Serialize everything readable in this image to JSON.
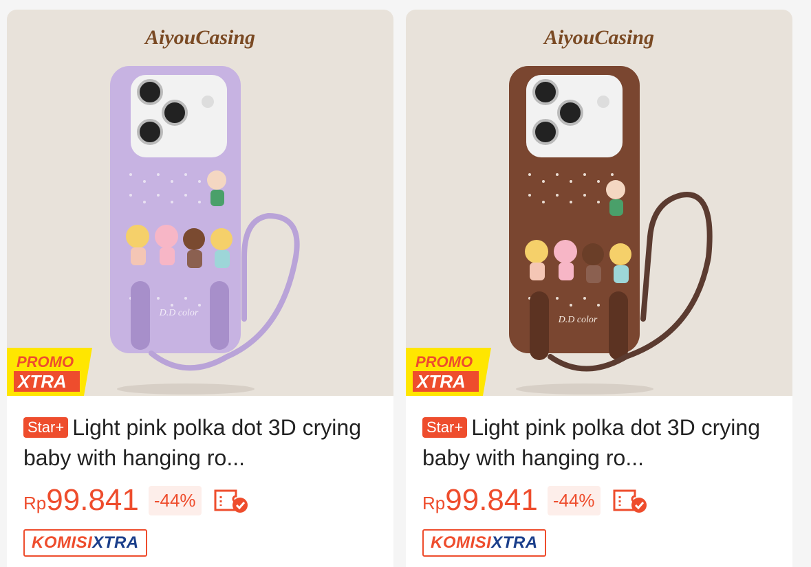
{
  "products": [
    {
      "brand": "AiyouCasing",
      "case_color": "#c7b3e2",
      "strap_color": "#b9a3d8",
      "promo_line1": "PROMO",
      "promo_line2": "XTRA",
      "case_text": "D.D color",
      "badge": "Star+",
      "title": "Light pink polka dot 3D crying baby with hanging ro...",
      "currency": "Rp",
      "price": "99.841",
      "discount": "-44%",
      "komisi_part1": "KOMISI",
      "komisi_part2": "XTRA"
    },
    {
      "brand": "AiyouCasing",
      "case_color": "#7a4630",
      "strap_color": "#5b3b30",
      "promo_line1": "PROMO",
      "promo_line2": "XTRA",
      "case_text": "D.D color",
      "badge": "Star+",
      "title": "Light pink polka dot 3D crying baby with hanging ro...",
      "currency": "Rp",
      "price": "99.841",
      "discount": "-44%",
      "komisi_part1": "KOMISI",
      "komisi_part2": "XTRA"
    }
  ],
  "colors": {
    "accent": "#ee4d2d",
    "promo_yellow": "#ffe600",
    "komisi_blue": "#1b3f8b"
  },
  "icons": {
    "voucher": "voucher-check-icon"
  }
}
